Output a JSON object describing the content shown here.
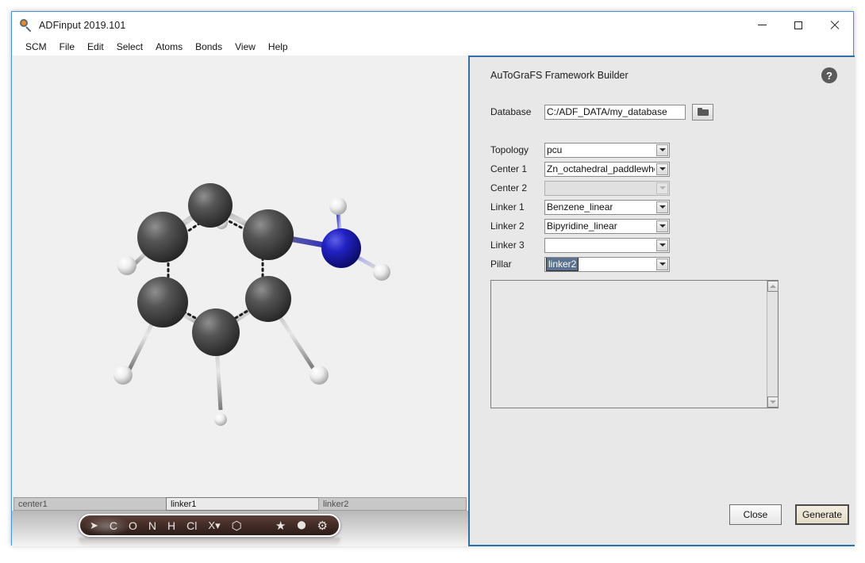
{
  "window": {
    "title": "ADFinput 2019.101",
    "icon": "magnifier-icon",
    "controls": {
      "minimize": "—",
      "maximize": "□",
      "close": "✕"
    }
  },
  "menu": {
    "items": [
      {
        "label": "SCM"
      },
      {
        "label": "File"
      },
      {
        "label": "Edit"
      },
      {
        "label": "Select"
      },
      {
        "label": "Atoms"
      },
      {
        "label": "Bonds"
      },
      {
        "label": "View"
      },
      {
        "label": "Help"
      }
    ]
  },
  "viewer": {
    "background": "#f0f0f0",
    "molecule_name": "aniline",
    "tabs": [
      {
        "label": "center1",
        "active": false
      },
      {
        "label": "linker1",
        "active": true
      },
      {
        "label": "linker2",
        "active": false
      }
    ],
    "toolbar": {
      "items": [
        {
          "name": "pointer-tool",
          "label": "➤"
        },
        {
          "name": "carbon-tool",
          "label": "C"
        },
        {
          "name": "oxygen-tool",
          "label": "O"
        },
        {
          "name": "nitrogen-tool",
          "label": "N"
        },
        {
          "name": "hydrogen-tool",
          "label": "H"
        },
        {
          "name": "chlorine-tool",
          "label": "Cl"
        },
        {
          "name": "element-picker-tool",
          "label": "X▾"
        },
        {
          "name": "ring-tool",
          "label": "⬡"
        }
      ],
      "right_items": [
        {
          "name": "star-tool",
          "label": "★"
        },
        {
          "name": "pin-tool",
          "label": "⬤"
        },
        {
          "name": "gear-tool",
          "label": "⚙"
        }
      ]
    },
    "atoms": {
      "carbon_color": "#3c3c3c",
      "nitrogen_color": "#2020c8",
      "hydrogen_color": "#f2f2f2"
    }
  },
  "panel": {
    "title": "AuToGraFS Framework Builder",
    "help_label": "?",
    "accent_color": "#2f6fa8",
    "database": {
      "label": "Database",
      "value": "C:/ADF_DATA/my_database",
      "placeholder": "",
      "browse_icon": "folder-icon"
    },
    "fields": [
      {
        "label": "Topology",
        "value": "pcu",
        "disabled": false,
        "selected": false
      },
      {
        "label": "Center 1",
        "value": "Zn_octahedral_paddlewheel",
        "disabled": false,
        "selected": false
      },
      {
        "label": "Center 2",
        "value": "",
        "disabled": true,
        "selected": false
      },
      {
        "label": "Linker 1",
        "value": "Benzene_linear",
        "disabled": false,
        "selected": false
      },
      {
        "label": "Linker 2",
        "value": "Bipyridine_linear",
        "disabled": false,
        "selected": false
      },
      {
        "label": "Linker 3",
        "value": "",
        "disabled": false,
        "selected": false
      },
      {
        "label": "Pillar",
        "value": "linker2",
        "disabled": false,
        "selected": true
      }
    ],
    "output": {
      "text": ""
    },
    "buttons": {
      "close": "Close",
      "generate": "Generate"
    }
  }
}
